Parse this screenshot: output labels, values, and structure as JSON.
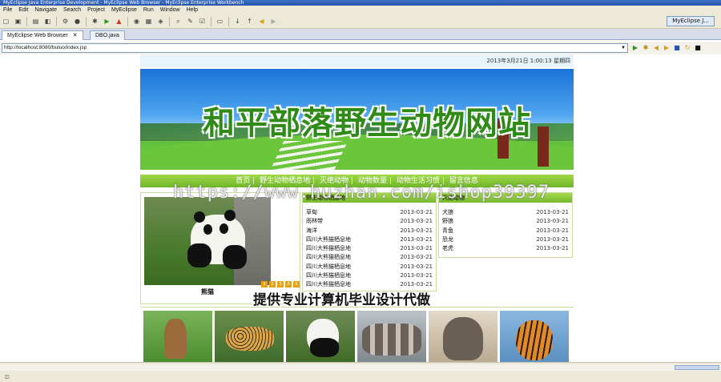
{
  "window": {
    "title": "MyEclipse Java Enterprise Development - MyEclipse Web Browser - MyEclipse Enterprise Workbench"
  },
  "menu": [
    "File",
    "Edit",
    "Navigate",
    "Search",
    "Project",
    "MyEclipse",
    "Run",
    "Window",
    "Help"
  ],
  "perspective": "MyEclipse J...",
  "tabs": [
    {
      "label": "MyEclipse Web Browser",
      "close": "✕"
    },
    {
      "label": "DBO.java"
    }
  ],
  "browser": {
    "url": "http://localhost:8080/buluo/index.jsp"
  },
  "page": {
    "date_text": "2013年3月21日 1:00:13  星期四",
    "site_title": "和平部落野生动物网站",
    "nav": [
      "首页",
      "野生动物栖息地",
      "灭绝动物",
      "动物数量",
      "动物生活习惯",
      "留言信息"
    ],
    "featured_caption": "熊猫",
    "slider_dots": [
      "1",
      "2",
      "3",
      "4",
      "5"
    ],
    "news_panel": {
      "title": "野生动物栖息地",
      "items": [
        {
          "name": "草甸",
          "date": "2013-03-21"
        },
        {
          "name": "雨林带",
          "date": "2013-03-21"
        },
        {
          "name": "海洋",
          "date": "2013-03-21"
        },
        {
          "name": "四川大熊猫栖息地",
          "date": "2013-03-21"
        },
        {
          "name": "四川大熊猫栖息地",
          "date": "2013-03-21"
        },
        {
          "name": "四川大熊猫栖息地",
          "date": "2013-03-21"
        },
        {
          "name": "四川大熊猫栖息地",
          "date": "2013-03-21"
        },
        {
          "name": "四川大熊猫栖息地",
          "date": "2013-03-21"
        },
        {
          "name": "四川大熊猫栖息地",
          "date": "2013-03-21"
        }
      ]
    },
    "extinct_panel": {
      "title": "灭绝动物",
      "items": [
        {
          "name": "犬狼",
          "date": "2013-03-21"
        },
        {
          "name": "野狼",
          "date": "2013-03-21"
        },
        {
          "name": "青鱼",
          "date": "2013-03-21"
        },
        {
          "name": "恐龙",
          "date": "2013-03-21"
        },
        {
          "name": "老虎",
          "date": "2013-03-21"
        }
      ]
    },
    "thumbnails": [
      "squirrel",
      "leopard",
      "panda",
      "wolves",
      "elephant",
      "tiger"
    ]
  },
  "overlay": {
    "watermark": "https://www.huzhan.com/ishop39397",
    "caption": "提供专业计算机毕业设计代做"
  },
  "colors": {
    "nav_green": "#7dbf32",
    "page_header_blue": "#e8f4fb",
    "title_green": "#2f8a18"
  }
}
